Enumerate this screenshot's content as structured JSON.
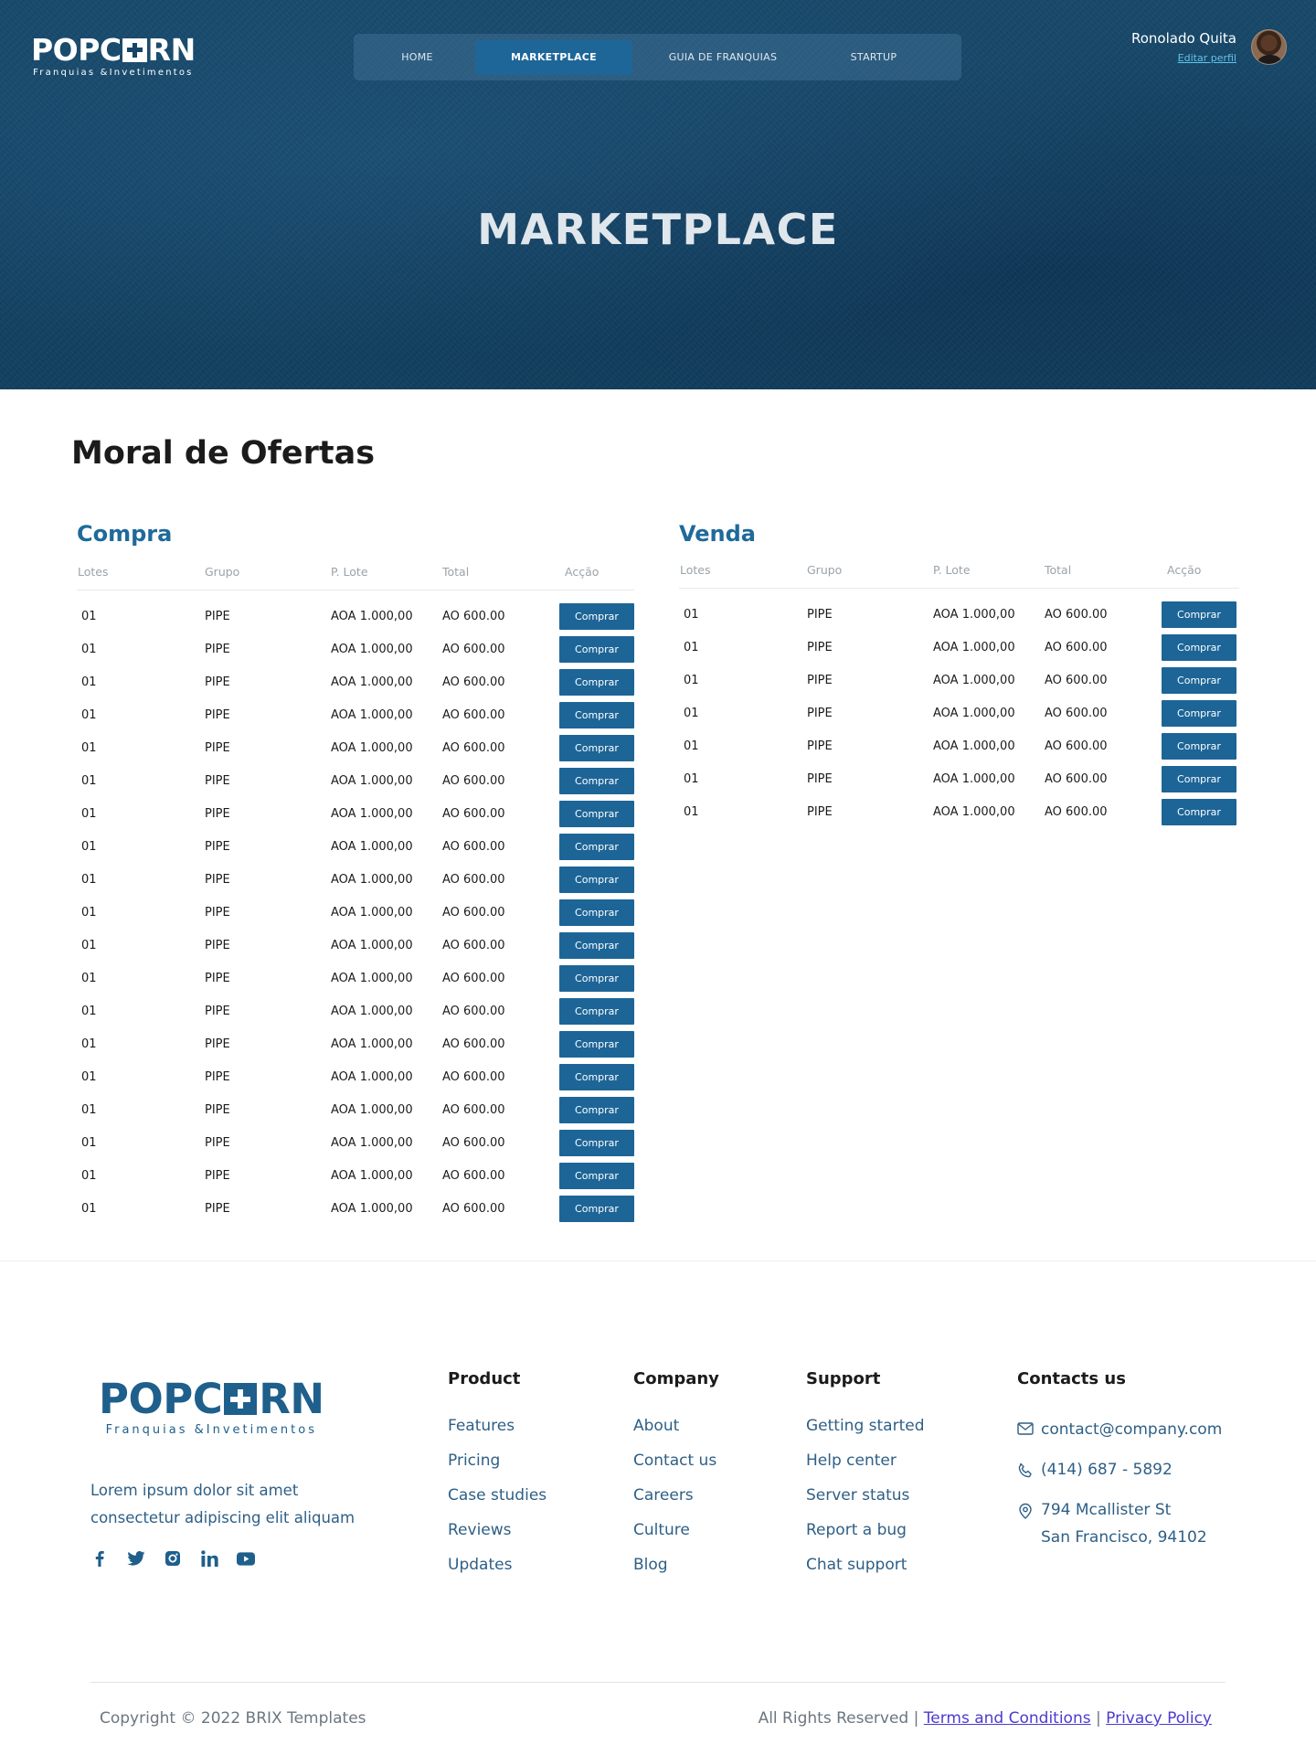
{
  "header": {
    "logo": {
      "word_left": "POPC",
      "word_right": "RN",
      "tagline": "Franquias &Invetimentos"
    },
    "nav": [
      {
        "label": "HOME",
        "active": false
      },
      {
        "label": "MARKETPLACE",
        "active": true
      },
      {
        "label": "GUIA DE FRANQUIAS",
        "active": false
      },
      {
        "label": "STARTUP",
        "active": false
      }
    ],
    "user": {
      "name": "Ronolado Quita",
      "edit_label": "Editar perfil"
    },
    "hero_title": "MARKETPLACE"
  },
  "main": {
    "section_title": "Moral de Ofertas",
    "columns": [
      "Lotes",
      "Grupo",
      "P. Lote",
      "Total",
      "Acção"
    ],
    "compra": {
      "title": "Compra",
      "rows": [
        {
          "lotes": "01",
          "grupo": "PIPE",
          "plote": "AOA 1.000,00",
          "total": "AO 600.00",
          "action": "Comprar"
        },
        {
          "lotes": "01",
          "grupo": "PIPE",
          "plote": "AOA 1.000,00",
          "total": "AO 600.00",
          "action": "Comprar"
        },
        {
          "lotes": "01",
          "grupo": "PIPE",
          "plote": "AOA 1.000,00",
          "total": "AO 600.00",
          "action": "Comprar"
        },
        {
          "lotes": "01",
          "grupo": "PIPE",
          "plote": "AOA 1.000,00",
          "total": "AO 600.00",
          "action": "Comprar"
        },
        {
          "lotes": "01",
          "grupo": "PIPE",
          "plote": "AOA 1.000,00",
          "total": "AO 600.00",
          "action": "Comprar"
        },
        {
          "lotes": "01",
          "grupo": "PIPE",
          "plote": "AOA 1.000,00",
          "total": "AO 600.00",
          "action": "Comprar"
        },
        {
          "lotes": "01",
          "grupo": "PIPE",
          "plote": "AOA 1.000,00",
          "total": "AO 600.00",
          "action": "Comprar"
        },
        {
          "lotes": "01",
          "grupo": "PIPE",
          "plote": "AOA 1.000,00",
          "total": "AO 600.00",
          "action": "Comprar"
        },
        {
          "lotes": "01",
          "grupo": "PIPE",
          "plote": "AOA 1.000,00",
          "total": "AO 600.00",
          "action": "Comprar"
        },
        {
          "lotes": "01",
          "grupo": "PIPE",
          "plote": "AOA 1.000,00",
          "total": "AO 600.00",
          "action": "Comprar"
        },
        {
          "lotes": "01",
          "grupo": "PIPE",
          "plote": "AOA 1.000,00",
          "total": "AO 600.00",
          "action": "Comprar"
        },
        {
          "lotes": "01",
          "grupo": "PIPE",
          "plote": "AOA 1.000,00",
          "total": "AO 600.00",
          "action": "Comprar"
        },
        {
          "lotes": "01",
          "grupo": "PIPE",
          "plote": "AOA 1.000,00",
          "total": "AO 600.00",
          "action": "Comprar"
        },
        {
          "lotes": "01",
          "grupo": "PIPE",
          "plote": "AOA 1.000,00",
          "total": "AO 600.00",
          "action": "Comprar"
        },
        {
          "lotes": "01",
          "grupo": "PIPE",
          "plote": "AOA 1.000,00",
          "total": "AO 600.00",
          "action": "Comprar"
        },
        {
          "lotes": "01",
          "grupo": "PIPE",
          "plote": "AOA 1.000,00",
          "total": "AO 600.00",
          "action": "Comprar"
        },
        {
          "lotes": "01",
          "grupo": "PIPE",
          "plote": "AOA 1.000,00",
          "total": "AO 600.00",
          "action": "Comprar"
        },
        {
          "lotes": "01",
          "grupo": "PIPE",
          "plote": "AOA 1.000,00",
          "total": "AO 600.00",
          "action": "Comprar"
        },
        {
          "lotes": "01",
          "grupo": "PIPE",
          "plote": "AOA 1.000,00",
          "total": "AO 600.00",
          "action": "Comprar"
        }
      ]
    },
    "venda": {
      "title": "Venda",
      "rows": [
        {
          "lotes": "01",
          "grupo": "PIPE",
          "plote": "AOA 1.000,00",
          "total": "AO 600.00",
          "action": "Comprar"
        },
        {
          "lotes": "01",
          "grupo": "PIPE",
          "plote": "AOA 1.000,00",
          "total": "AO 600.00",
          "action": "Comprar"
        },
        {
          "lotes": "01",
          "grupo": "PIPE",
          "plote": "AOA 1.000,00",
          "total": "AO 600.00",
          "action": "Comprar"
        },
        {
          "lotes": "01",
          "grupo": "PIPE",
          "plote": "AOA 1.000,00",
          "total": "AO 600.00",
          "action": "Comprar"
        },
        {
          "lotes": "01",
          "grupo": "PIPE",
          "plote": "AOA 1.000,00",
          "total": "AO 600.00",
          "action": "Comprar"
        },
        {
          "lotes": "01",
          "grupo": "PIPE",
          "plote": "AOA 1.000,00",
          "total": "AO 600.00",
          "action": "Comprar"
        },
        {
          "lotes": "01",
          "grupo": "PIPE",
          "plote": "AOA 1.000,00",
          "total": "AO 600.00",
          "action": "Comprar"
        }
      ]
    }
  },
  "footer": {
    "logo": {
      "word_left": "POPC",
      "word_right": "RN",
      "tagline": "Franquias &Invetimentos"
    },
    "description": "Lorem ipsum dolor sit amet consectetur adipiscing elit aliquam",
    "social": [
      "facebook-icon",
      "twitter-icon",
      "instagram-icon",
      "linkedin-icon",
      "youtube-icon"
    ],
    "product": {
      "title": "Product",
      "links": [
        "Features",
        "Pricing",
        "Case studies",
        "Reviews",
        "Updates"
      ]
    },
    "company": {
      "title": "Company",
      "links": [
        "About",
        "Contact us",
        "Careers",
        "Culture",
        "Blog"
      ]
    },
    "support": {
      "title": "Support",
      "links": [
        "Getting started",
        "Help center",
        "Server status",
        "Report a bug",
        "Chat support"
      ]
    },
    "contacts": {
      "title": "Contacts us",
      "email": "contact@company.com",
      "phone": "(414) 687 - 5892",
      "address_line1": "794 Mcallister St",
      "address_line2": "San Francisco, 94102"
    },
    "copyright": "Copyright © 2022 BRIX Templates",
    "rights_prefix": "All Rights Reserved |",
    "terms": "Terms and Conditions",
    "separator": "|",
    "privacy": "Privacy Policy"
  },
  "colors": {
    "brand": "#1e5f8c",
    "button": "#1d6597",
    "nav_active": "#1e6698",
    "link_accent": "#5fc4e8"
  }
}
